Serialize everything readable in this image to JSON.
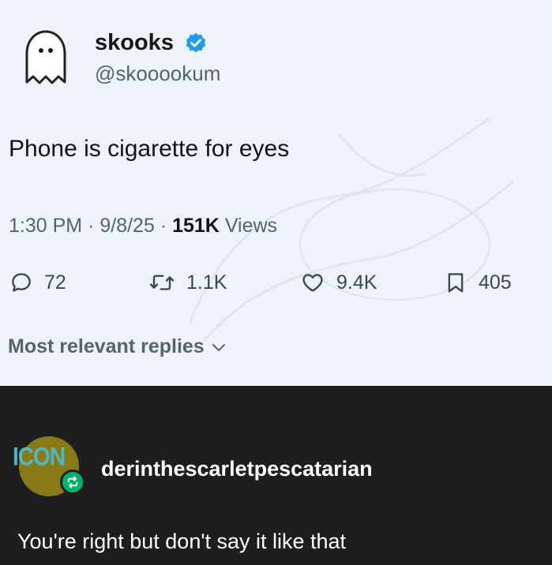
{
  "tweet": {
    "author": {
      "name": "skooks",
      "handle": "@skooookum",
      "verified": true
    },
    "text": "Phone is cigarette for eyes",
    "time": "1:30 PM",
    "date": "9/8/25",
    "views_count": "151K",
    "views_label": "Views",
    "meta_sep": "·",
    "actions": {
      "replies": "72",
      "retweets": "1.1K",
      "likes": "9.4K",
      "bookmarks": "405"
    },
    "sort_label": "Most relevant replies"
  },
  "reply": {
    "avatar_text": "ICON",
    "username": "derinthescarletpescatarian",
    "text": "You're right but don't say it like that"
  },
  "colors": {
    "tweet_bg": "#eef3fa",
    "reply_bg": "#1e1e20",
    "verified_blue": "#1d9bf0",
    "reblog_green": "#00b36b"
  }
}
